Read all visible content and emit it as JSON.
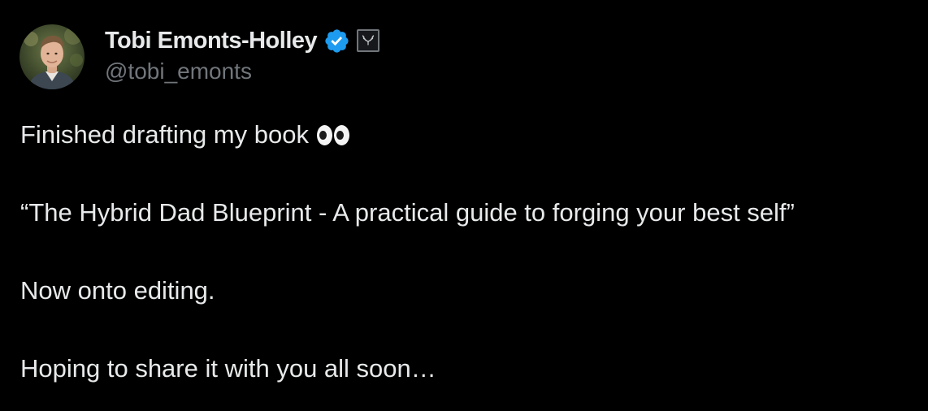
{
  "author": {
    "display_name": "Tobi Emonts-Holley",
    "handle": "@tobi_emonts",
    "verified_color": "#1d9bf0",
    "verified_icon": "verified-badge-icon",
    "affiliate_icon": "antlers-icon"
  },
  "tweet": {
    "line1": "Finished drafting my book",
    "line1_emoji": "eyes-emoji",
    "line2": "“The Hybrid Dad Blueprint - A practical guide to forging your best self”",
    "line3": "Now onto editing.",
    "line4": "Hoping to share it with you all soon…"
  },
  "colors": {
    "background": "#000000",
    "primary_text": "#e7e9ea",
    "secondary_text": "#71767b"
  }
}
